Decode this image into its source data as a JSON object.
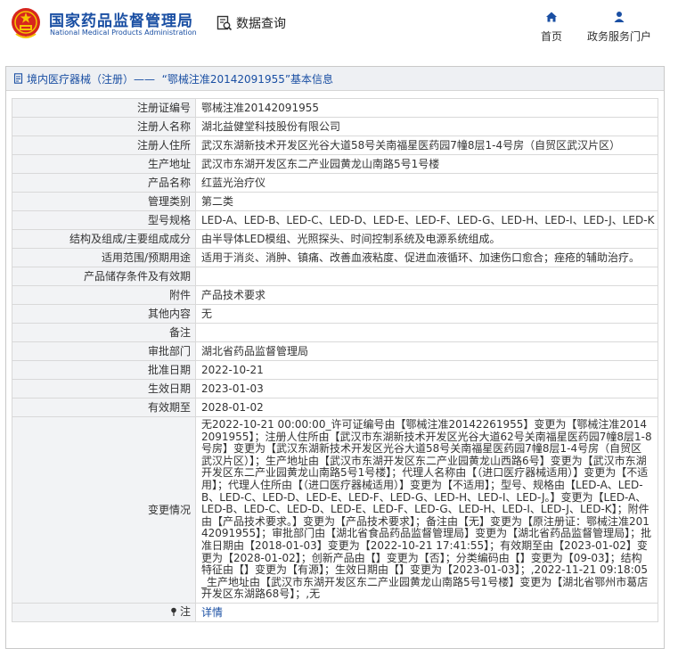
{
  "header": {
    "brand_cn": "国家药品监督管理局",
    "brand_en": "National Medical Products Administration",
    "search_label": "数据查询",
    "nav": [
      {
        "label": "首页",
        "icon": "home-icon"
      },
      {
        "label": "政务服务门户",
        "icon": "user-icon"
      }
    ]
  },
  "panel": {
    "title_prefix": "境内医疗器械（注册）",
    "title_suffix": "——  “鄂械注准20142091955”基本信息"
  },
  "rows": [
    {
      "label": "注册证编号",
      "value": "鄂械注准20142091955"
    },
    {
      "label": "注册人名称",
      "value": "湖北益健堂科技股份有限公司"
    },
    {
      "label": "注册人住所",
      "value": "武汉东湖新技术开发区光谷大道58号关南福星医药园7幢8层1-4号房（自贸区武汉片区）"
    },
    {
      "label": "生产地址",
      "value": "武汉市东湖开发区东二产业园黄龙山南路5号1号楼"
    },
    {
      "label": "产品名称",
      "value": "红蓝光治疗仪"
    },
    {
      "label": "管理类别",
      "value": "第二类"
    },
    {
      "label": "型号规格",
      "value": "LED-A、LED-B、LED-C、LED-D、LED-E、LED-F、LED-G、LED-H、LED-I、LED-J、LED-K"
    },
    {
      "label": "结构及组成/主要组成成分",
      "value": "由半导体LED模组、光照探头、时间控制系统及电源系统组成。"
    },
    {
      "label": "适用范围/预期用途",
      "value": "适用于消炎、消肿、镇痛、改善血液粘度、促进血液循环、加速伤口愈合；痤疮的辅助治疗。"
    },
    {
      "label": "产品储存条件及有效期",
      "value": ""
    },
    {
      "label": "附件",
      "value": "产品技术要求"
    },
    {
      "label": "其他内容",
      "value": "无"
    },
    {
      "label": "备注",
      "value": ""
    },
    {
      "label": "审批部门",
      "value": "湖北省药品监督管理局"
    },
    {
      "label": "批准日期",
      "value": "2022-10-21"
    },
    {
      "label": "生效日期",
      "value": "2023-01-03"
    },
    {
      "label": "有效期至",
      "value": "2028-01-02"
    }
  ],
  "change": {
    "label": "变更情况",
    "value": "无2022-10-21 00:00:00_许可证编号由【鄂械注准20142261955】变更为【鄂械注准20142091955】；注册人住所由【武汉市东湖新技术开发区光谷大道62号关南福星医药园7幢8层1-8号房】变更为【武汉东湖新技术开发区光谷大道58号关南福星医药园7幢8层1-4号房（自贸区武汉片区）】；生产地址由【武汉市东湖开发区东二产业园黄龙山西路6号】变更为【武汉市东湖开发区东二产业园黄龙山南路5号1号楼】；代理人名称由【（进口医疗器械适用）】变更为【不适用】；代理人住所由【（进口医疗器械适用）】变更为【不适用】；型号、规格由【LED-A、LED-B、LED-C、LED-D、LED-E、LED-F、LED-G、LED-H、LED-I、LED-J。】变更为【LED-A、LED-B、LED-C、LED-D、LED-E、LED-F、LED-G、LED-H、LED-I、LED-J、LED-K】；附件由【产品技术要求。】变更为【产品技术要求】；备注由【无】变更为【原注册证：鄂械注准20142091955】；审批部门由【湖北省食品药品监督管理局】变更为【湖北省药品监督管理局】；批准日期由【2018-01-03】变更为【2022-10-21 17:41:55】；有效期至由【2023-01-02】变更为【2028-01-02】；创新产品由【】变更为【否】；分类编码由【】变更为【09-03】；结构特征由【】变更为【有源】；生效日期由【】变更为【2023-01-03】；,2022-11-21 09:18:05_生产地址由【武汉市东湖开发区东二产业园黄龙山南路5号1号楼】变更为【湖北省鄂州市葛店开发区东湖路68号】；,无"
  },
  "note": {
    "label": "注",
    "link": "详情"
  },
  "colors": {
    "brand_blue": "#1a4fa3",
    "emblem_red": "#d7261e",
    "emblem_gold": "#f5c400"
  }
}
